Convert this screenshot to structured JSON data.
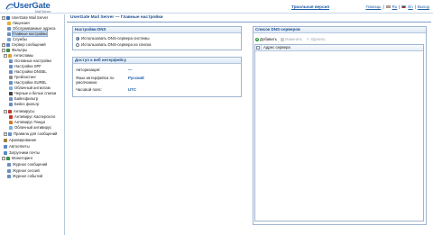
{
  "header": {
    "logo_main": "UserGate",
    "logo_sub": "Mail Server",
    "trial_link": "Триальная версия",
    "help_link": "Помощь",
    "lang_ru": "Ru",
    "lang_en": "En",
    "logout_link": "Выход"
  },
  "sidebar": {
    "items": [
      {
        "label": "UserGate Mail Server",
        "icon": "server-icon",
        "color": "#3c6fb5"
      },
      {
        "label": "Лицензия",
        "icon": "license-icon",
        "color": "#e0b030"
      },
      {
        "label": "Обслуживаемые адреса",
        "icon": "address-icon",
        "color": "#6a8fc0"
      },
      {
        "label": "Главные настройки",
        "icon": "settings-icon",
        "color": "#6a8fc0"
      },
      {
        "label": "Службы",
        "icon": "services-icon",
        "color": "#7aa0cf"
      },
      {
        "label": "Сервер сообщений",
        "icon": "message-server-icon",
        "color": "#5b88c4"
      },
      {
        "label": "Фильтры",
        "icon": "filter-icon",
        "color": "#3f8f44"
      },
      {
        "label": "Антиспамы",
        "icon": "antispam-icon",
        "color": "#d7a23b"
      },
      {
        "label": "Основные настройки",
        "icon": "basic-settings-icon",
        "color": "#6a8fc0"
      },
      {
        "label": "Настройки SPF",
        "icon": "spf-icon",
        "color": "#6a8fc0"
      },
      {
        "label": "Настройки DNSBL",
        "icon": "dnsbl-icon",
        "color": "#6a8fc0"
      },
      {
        "label": "Грейлистинг",
        "icon": "greylist-icon",
        "color": "#8e8e8e"
      },
      {
        "label": "Настройки SURBL",
        "icon": "surbl-icon",
        "color": "#6a8fc0"
      },
      {
        "label": "Облачный антиспам",
        "icon": "cloud-antispam-icon",
        "color": "#7db0e0"
      },
      {
        "label": "Черные и белые списки",
        "icon": "black-white-list-icon",
        "color": "#444444"
      },
      {
        "label": "Байесфильтр",
        "icon": "bayes-filter-icon",
        "color": "#6a8fc0"
      },
      {
        "label": "Бейес фильтр",
        "icon": "bayes-icon",
        "color": "#6a8fc0"
      },
      {
        "label": "Антивирусы",
        "icon": "antivirus-icon",
        "color": "#c03a2b"
      },
      {
        "label": "Антивирус Касперского",
        "icon": "kaspersky-icon",
        "color": "#c03a2b"
      },
      {
        "label": "Антивирус Панда",
        "icon": "panda-icon",
        "color": "#d6792a"
      },
      {
        "label": "Облачный антивирус",
        "icon": "cloud-antivirus-icon",
        "color": "#7db0e0"
      },
      {
        "label": "Правила для сообщений",
        "icon": "rules-icon",
        "color": "#6a8fc0"
      },
      {
        "label": "Архивирование",
        "icon": "archive-icon",
        "color": "#a08040"
      },
      {
        "label": "Автоответы",
        "icon": "autoreply-icon",
        "color": "#5b88c4"
      },
      {
        "label": "Загрузчики почты",
        "icon": "mail-loader-icon",
        "color": "#5b88c4"
      },
      {
        "label": "Мониторинг",
        "icon": "monitoring-icon",
        "color": "#3f8f44"
      },
      {
        "label": "Журнал сообщений",
        "icon": "message-log-icon",
        "color": "#6a8fc0"
      },
      {
        "label": "Журнал сессий",
        "icon": "session-log-icon",
        "color": "#6a8fc0"
      },
      {
        "label": "Журнал событий",
        "icon": "event-log-icon",
        "color": "#6a8fc0"
      }
    ]
  },
  "main": {
    "title": "UserGate Mail Server — Главные настройки",
    "dns_panel": {
      "heading": "Настройки DNS",
      "option_system": "Использовать DNS-сервера системы",
      "option_list": "Использовать DNS-сервера из списка"
    },
    "web_panel": {
      "heading": "Доступ к веб интерфейсу",
      "auth_label": "Авторизация:",
      "auth_value": "—",
      "lang_label": "Язык интерфейса по умолчанию:",
      "lang_value": "Русский",
      "tz_label": "Часовой пояс:",
      "tz_value": "UTC"
    },
    "dns_list": {
      "heading": "Список DNS-серверов",
      "add_label": "Добавить",
      "edit_label": "Изменить",
      "delete_label": "Удалить",
      "column_header": "Адрес сервера"
    }
  }
}
